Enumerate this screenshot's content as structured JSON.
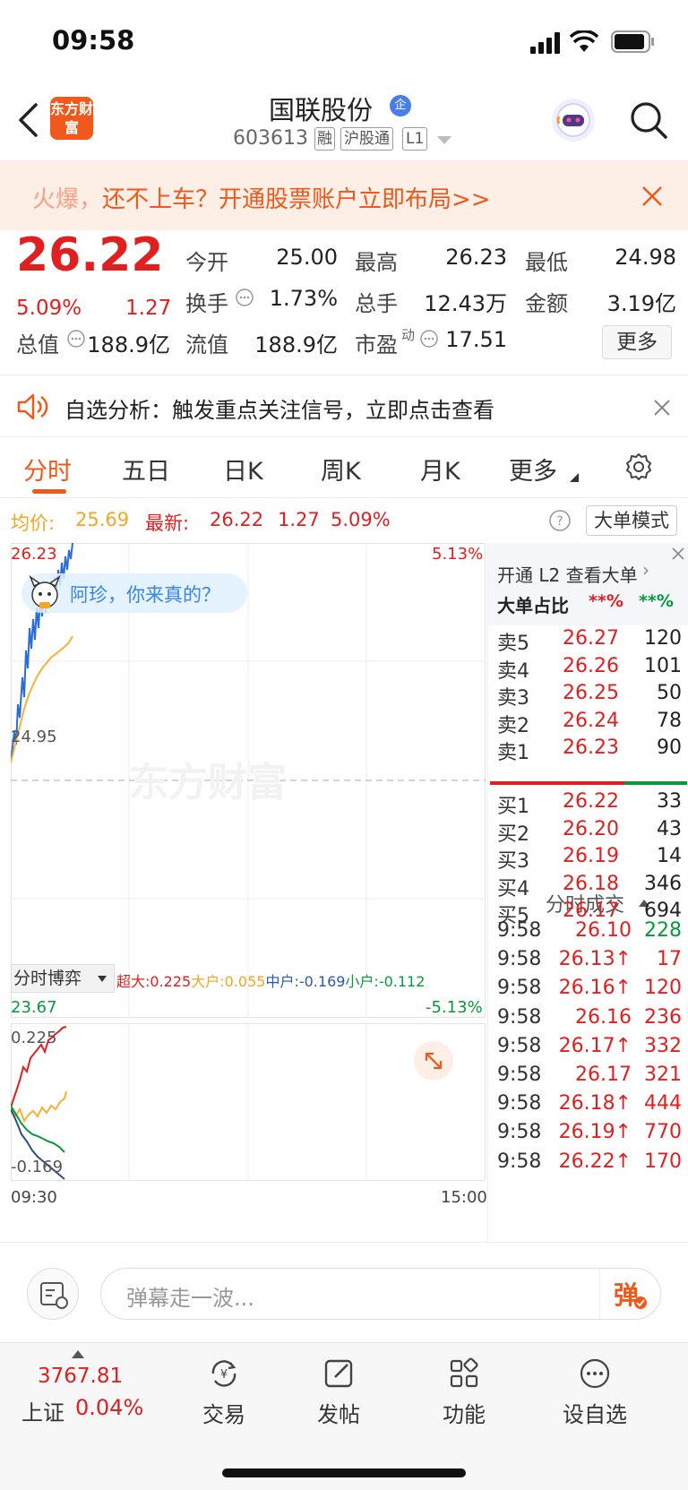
{
  "status_bar": {
    "time": "09:58"
  },
  "header": {
    "logo_text": "东方财富",
    "stock_name": "国联股份",
    "badge": "企",
    "code": "603613",
    "tags": [
      "融",
      "沪股通",
      "L1"
    ]
  },
  "promo": {
    "hot": "火爆，",
    "text": "还不上车？开通股票账户立即布局>>"
  },
  "quote": {
    "price": "26.22",
    "pct": "5.09%",
    "chg": "1.27",
    "fields": [
      {
        "label": "今开",
        "value": "25.00"
      },
      {
        "label": "最高",
        "value": "26.23"
      },
      {
        "label": "最低",
        "value": "24.98"
      },
      {
        "label": "换手",
        "value": "1.73%"
      },
      {
        "label": "总手",
        "value": "12.43万"
      },
      {
        "label": "金额",
        "value": "3.19亿"
      },
      {
        "label": "总值",
        "value": "188.9亿"
      },
      {
        "label": "流值",
        "value": "188.9亿"
      },
      {
        "label": "市盈",
        "value": "17.51"
      }
    ],
    "pe_sup": "动",
    "more": "更多"
  },
  "notice": {
    "text": "自选分析：触发重点关注信号，立即点击查看"
  },
  "tabs": [
    "分时",
    "五日",
    "日K",
    "周K",
    "月K",
    "更多"
  ],
  "avgbar": {
    "avg_label": "均价:",
    "avg": "25.69",
    "last_label": "最新:",
    "last": "26.22",
    "chg": "1.27",
    "pct": "5.09%",
    "mode": "大单模式"
  },
  "chart": {
    "y_top": "26.23",
    "y_mid": "24.95",
    "y_bot": "23.67",
    "pct_top": "5.13%",
    "pct_bot": "-5.13%",
    "watermark": "东方财富",
    "bubble": "阿珍，你来真的？",
    "sub_select": "分时博弈",
    "legend": [
      {
        "label": "超大:",
        "value": "0.225",
        "color": "#e02020"
      },
      {
        "label": "大户:",
        "value": "0.055",
        "color": "#f5a623"
      },
      {
        "label": "中户:",
        "value": "-0.169",
        "color": "#2a5aa8"
      },
      {
        "label": "小户:",
        "value": "-0.112",
        "color": "#079a3a"
      }
    ],
    "sub_top": "0.225",
    "sub_bot": "-0.169",
    "time_start": "09:30",
    "time_end": "15:00"
  },
  "book": {
    "l2_text": "开通 L2 查看大单",
    "ratio_label": "大单占比",
    "ratio_red": "**%",
    "ratio_green": "**%",
    "asks": [
      {
        "label": "卖5",
        "price": "26.27",
        "vol": "120"
      },
      {
        "label": "卖4",
        "price": "26.26",
        "vol": "101"
      },
      {
        "label": "卖3",
        "price": "26.25",
        "vol": "50"
      },
      {
        "label": "卖2",
        "price": "26.24",
        "vol": "78"
      },
      {
        "label": "卖1",
        "price": "26.23",
        "vol": "90"
      }
    ],
    "bids": [
      {
        "label": "买1",
        "price": "26.22",
        "vol": "33"
      },
      {
        "label": "买2",
        "price": "26.20",
        "vol": "43"
      },
      {
        "label": "买3",
        "price": "26.19",
        "vol": "14"
      },
      {
        "label": "买4",
        "price": "26.18",
        "vol": "346"
      },
      {
        "label": "买5",
        "price": "26.17",
        "vol": "694"
      }
    ],
    "ticks_title": "分时成交",
    "ticks": [
      {
        "time": "9:58",
        "price": "26.10",
        "vol": "228",
        "pc": "red",
        "vc": "green"
      },
      {
        "time": "9:58",
        "price": "26.13↑",
        "vol": "17",
        "pc": "red",
        "vc": "red"
      },
      {
        "time": "9:58",
        "price": "26.16↑",
        "vol": "120",
        "pc": "red",
        "vc": "red"
      },
      {
        "time": "9:58",
        "price": "26.16",
        "vol": "236",
        "pc": "red",
        "vc": "red"
      },
      {
        "time": "9:58",
        "price": "26.17↑",
        "vol": "332",
        "pc": "red",
        "vc": "red"
      },
      {
        "time": "9:58",
        "price": "26.17",
        "vol": "321",
        "pc": "red",
        "vc": "red"
      },
      {
        "time": "9:58",
        "price": "26.18↑",
        "vol": "444",
        "pc": "red",
        "vc": "red"
      },
      {
        "time": "9:58",
        "price": "26.19↑",
        "vol": "770",
        "pc": "red",
        "vc": "red"
      },
      {
        "time": "9:58",
        "price": "26.22↑",
        "vol": "170",
        "pc": "red",
        "vc": "red"
      }
    ]
  },
  "danmu": {
    "placeholder": "弹幕走一波...",
    "btn": "弹"
  },
  "bottom": {
    "index_value": "3767.81",
    "index_name": "上证",
    "index_pct": "0.04%",
    "nav": [
      "交易",
      "发帖",
      "功能",
      "设自选"
    ]
  }
}
